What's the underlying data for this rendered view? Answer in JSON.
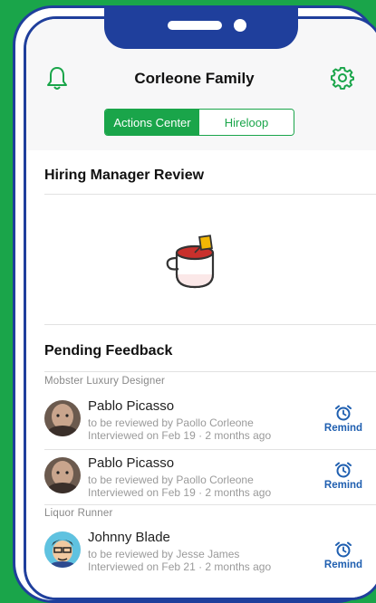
{
  "header": {
    "title": "Corleone Family"
  },
  "tabs": [
    {
      "label": "Actions Center",
      "active": true
    },
    {
      "label": "Hireloop",
      "active": false
    }
  ],
  "sections": {
    "review_title": "Hiring Manager Review",
    "pending_title": "Pending Feedback"
  },
  "groups": [
    {
      "title": "Mobster Luxury Designer",
      "items": [
        {
          "name": "Pablo Picasso",
          "reviewer": "to be reviewed by Paollo Corleone",
          "interviewed": "Interviewed on Feb 19 · 2 months ago",
          "action": "Remind"
        },
        {
          "name": "Pablo Picasso",
          "reviewer": "to be reviewed by Paollo Corleone",
          "interviewed": "Interviewed on Feb 19 · 2 months ago",
          "action": "Remind"
        }
      ]
    },
    {
      "title": "Liquor Runner",
      "items": [
        {
          "name": "Johnny Blade",
          "reviewer": "to be reviewed by Jesse James",
          "interviewed": "Interviewed on Feb 21 · 2 months ago",
          "action": "Remind"
        }
      ]
    }
  ],
  "colors": {
    "brand_green": "#1aa54a",
    "frame_blue": "#1f3f9c",
    "remind_blue": "#1f5fb0"
  },
  "icons": {
    "left_header": "bell-icon",
    "right_header": "gear-icon",
    "empty_state": "coffee-cup-illustration",
    "action": "alarm-clock-icon"
  }
}
